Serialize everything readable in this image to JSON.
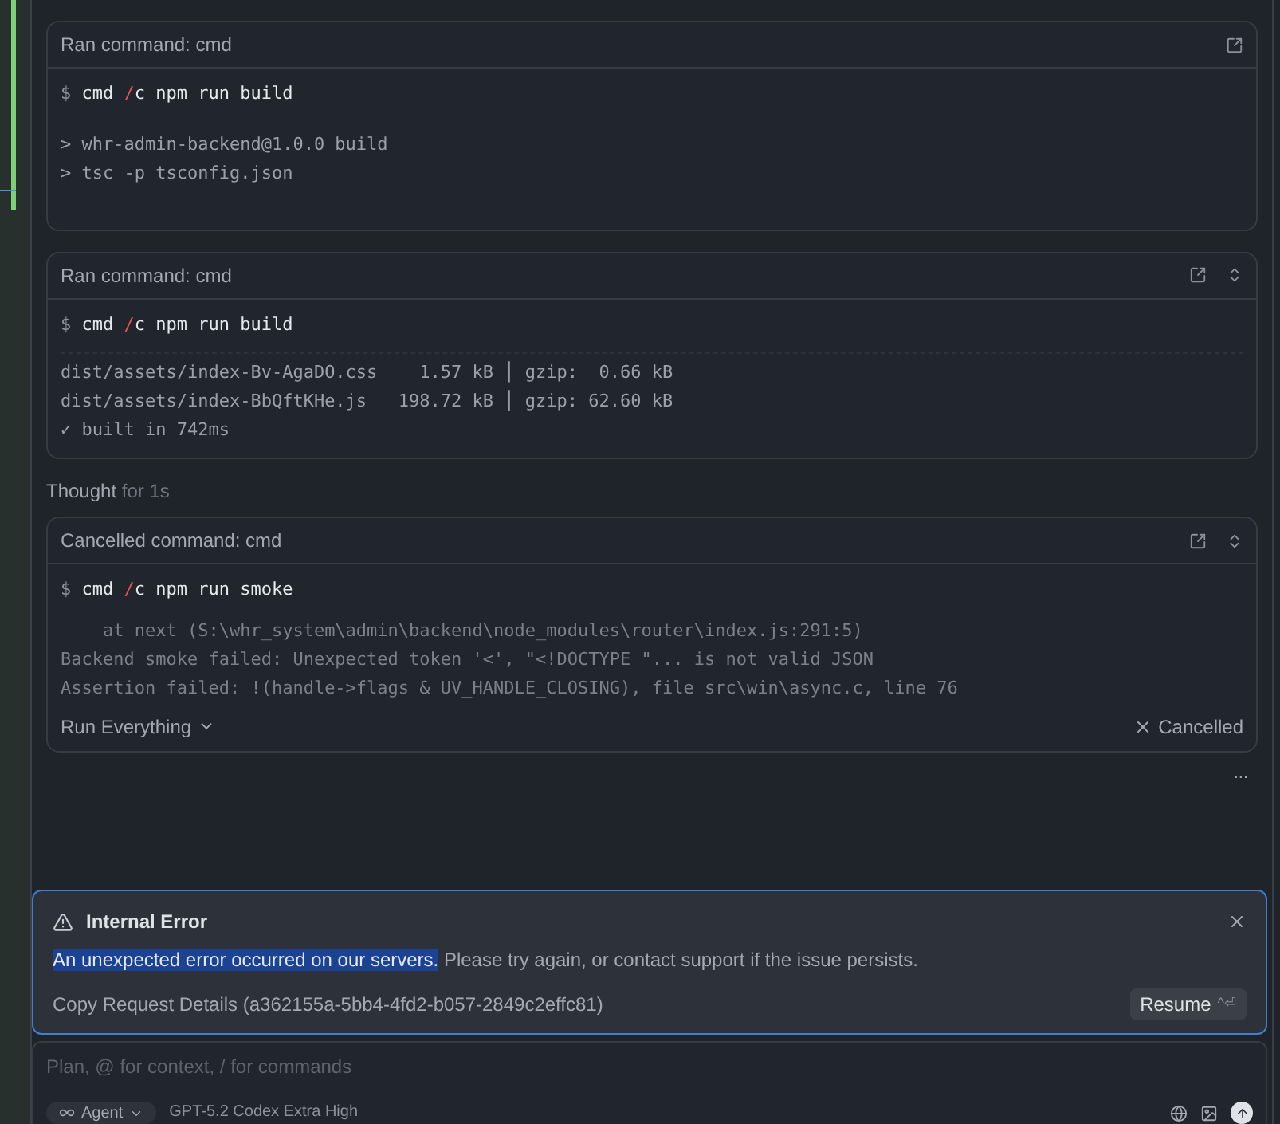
{
  "cards": [
    {
      "title": "Ran command: cmd",
      "collapsible": false,
      "prompt": "$",
      "command": [
        {
          "text": "cmd ",
          "kind": "plain"
        },
        {
          "text": "/",
          "kind": "flag"
        },
        {
          "text": "c npm run build",
          "kind": "plain"
        }
      ],
      "output": [
        "> whr-admin-backend@1.0.0 build",
        "> tsc -p tsconfig.json"
      ],
      "scrolled": false
    },
    {
      "title": "Ran command: cmd",
      "collapsible": true,
      "prompt": "$",
      "command": [
        {
          "text": "cmd ",
          "kind": "plain"
        },
        {
          "text": "/",
          "kind": "flag"
        },
        {
          "text": "c npm run build",
          "kind": "plain"
        }
      ],
      "output": [
        "dist/assets/index-Bv-AgaDO.css    1.57 kB │ gzip:  0.66 kB",
        "dist/assets/index-BbQftKHe.js   198.72 kB │ gzip: 62.60 kB",
        "✓ built in 742ms"
      ],
      "scrolled": true
    }
  ],
  "thought": {
    "label": "Thought",
    "duration": "for 1s"
  },
  "cancelled_card": {
    "title": "Cancelled command: cmd",
    "collapsible": true,
    "prompt": "$",
    "command": [
      {
        "text": "cmd ",
        "kind": "plain"
      },
      {
        "text": "/",
        "kind": "flag"
      },
      {
        "text": "c npm run smoke",
        "kind": "plain"
      }
    ],
    "output": [
      "    at next (S:\\whr_system\\admin\\backend\\node_modules\\router\\index.js:291:5)",
      "Backend smoke failed: Unexpected token '<', \"<!DOCTYPE \"... is not valid JSON",
      "Assertion failed: !(handle->flags & UV_HANDLE_CLOSING), file src\\win\\async.c, line 76"
    ],
    "run_mode": "Run Everything",
    "status": "Cancelled"
  },
  "more": "...",
  "error": {
    "title": "Internal Error",
    "highlighted": "An unexpected error occurred on our servers.",
    "message": " Please try again, or contact support if the issue persists.",
    "details": "Copy Request Details (a362155a-5bb4-4fd2-b057-2849c2effc81)",
    "resume": "Resume",
    "shortcut": "^⏎"
  },
  "composer": {
    "placeholder": "Plan, @ for context, / for commands",
    "mode": "Agent",
    "model": "GPT-5.2 Codex Extra High"
  }
}
